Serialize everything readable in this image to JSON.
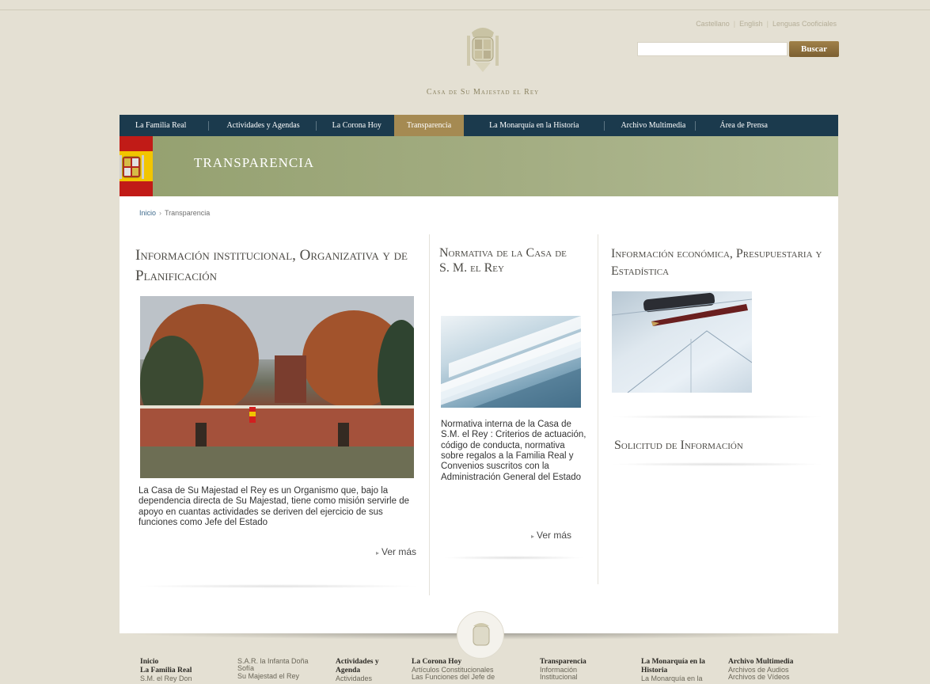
{
  "header": {
    "languages": [
      "Castellano",
      "English",
      "Lenguas Cooficiales"
    ],
    "search_button": "Buscar",
    "house_title": "Casa de Su Majestad el Rey"
  },
  "nav": {
    "items": [
      {
        "label": "La Familia Real"
      },
      {
        "label": "Actividades y Agendas"
      },
      {
        "label": "La Corona Hoy"
      },
      {
        "label": "Transparencia"
      },
      {
        "label": "La Monarquía en la Historia"
      },
      {
        "label": "Archivo Multimedia"
      },
      {
        "label": "Área de Prensa"
      }
    ],
    "active_index": 3
  },
  "banner": {
    "title": "TRANSPARENCIA"
  },
  "breadcrumb": {
    "home": "Inicio",
    "current": "Transparencia"
  },
  "columns": {
    "col1": {
      "title": "Información institucional, Organizativa y de Planificación",
      "text": "La Casa de Su Majestad el Rey es un Organismo que, bajo la dependencia directa de Su Majestad, tiene como misión servirle de apoyo en cuantas actividades se deriven del ejercicio de sus funciones como Jefe del Estado",
      "more": "Ver más"
    },
    "col2": {
      "title": "Normativa de la Casa de S. M. el Rey",
      "text": "Normativa interna de la Casa de S.M. el Rey : Criterios de actuación, código de conducta, normativa sobre regalos a la Familia Real y Convenios suscritos con la Administración General del Estado",
      "more": "Ver más"
    },
    "col3": {
      "title": "Información económica, Presupuestaria y Estadística",
      "title2": "Solicitud de Información"
    }
  },
  "footer": {
    "columns": [
      {
        "title": "Inicio",
        "lines": [
          "La Familia Real",
          "S.M. el Rey Don"
        ]
      },
      {
        "title": "",
        "lines": [
          "S.A.R. la Infanta Doña",
          "Sofía",
          "Su Majestad el Rey"
        ]
      },
      {
        "title": "Actividades y",
        "lines": [
          "Agenda",
          "Actividades"
        ]
      },
      {
        "title": "La Corona Hoy",
        "lines": [
          "Artículos Constitucionales",
          "Las Funciones del Jefe de"
        ]
      },
      {
        "title": "Transparencia",
        "lines": [
          "Información",
          "Institucional"
        ]
      },
      {
        "title": "La Monarquía en la",
        "lines": [
          "Historia",
          "La Monarquía en la"
        ]
      },
      {
        "title": "Archivo Multimedia",
        "lines": [
          "Archivos de Audios",
          "Archivos de Vídeos"
        ]
      }
    ]
  }
}
